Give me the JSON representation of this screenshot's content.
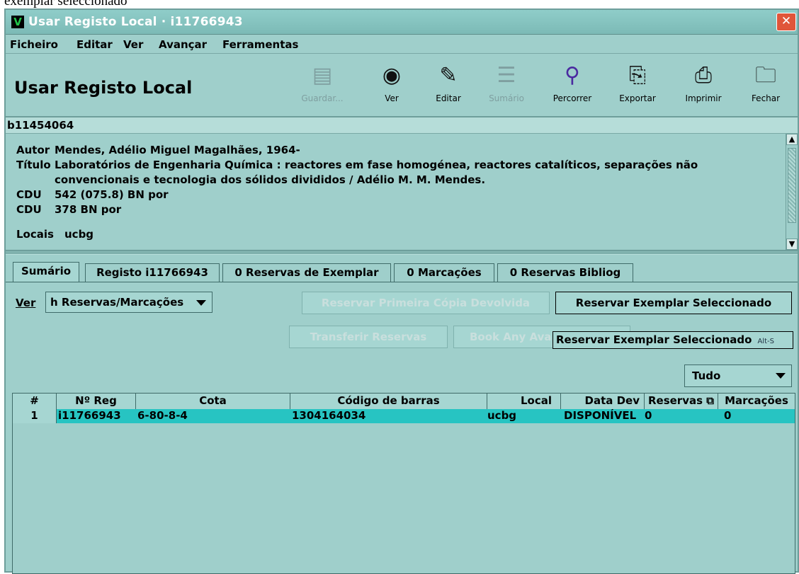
{
  "caption_fragment": "exemplar seleccionado",
  "window": {
    "title": "Usar Registo Local · i11766943",
    "close_glyph": "✕",
    "app_icon": "V"
  },
  "menu": [
    "Ficheiro",
    "Editar",
    "Ver",
    "Avançar",
    "Ferramentas"
  ],
  "toolbar": {
    "title": "Usar Registo Local",
    "buttons": [
      {
        "label": "Guardar...",
        "icon": "save-icon",
        "enabled": false
      },
      {
        "label": "Ver",
        "icon": "eye-icon",
        "enabled": true
      },
      {
        "label": "Editar",
        "icon": "edit-icon",
        "enabled": true
      },
      {
        "label": "Sumário",
        "icon": "summary-icon",
        "enabled": false
      },
      {
        "label": "Percorrer",
        "icon": "magnifier-icon",
        "enabled": true
      },
      {
        "label": "Exportar",
        "icon": "export-icon",
        "enabled": true
      },
      {
        "label": "Imprimir",
        "icon": "printer-icon",
        "enabled": true
      },
      {
        "label": "Fechar",
        "icon": "close-folder-icon",
        "enabled": true
      }
    ]
  },
  "record": {
    "bib_id": "b11454064",
    "fields": [
      {
        "label": "Autor",
        "value": "Mendes, Adélio Miguel Magalhães, 1964-"
      },
      {
        "label": "Título",
        "value": "Laboratórios de Engenharia Química : reactores em fase homogénea, reactores catalíticos, separações não"
      },
      {
        "label": "",
        "value": "convencionais e tecnologia dos sólidos divididos / Adélio M. M. Mendes."
      },
      {
        "label": "CDU",
        "value": "542 (075.8) BN por"
      },
      {
        "label": "CDU",
        "value": "378 BN por"
      },
      {
        "label": "Locais",
        "value": "ucbg"
      }
    ]
  },
  "tabs": [
    "Sumário",
    "Registo i11766943",
    "0 Reservas de Exemplar",
    "0 Marcações",
    "0 Reservas Bibliog"
  ],
  "summary": {
    "ver_label": "Ver",
    "ver_value": "h Reservas/Marcações",
    "buttons": {
      "reservar_primeira": "Reservar Primeira Cópia Devolvida",
      "reservar_exemplar": "Reservar Exemplar Seleccionado",
      "transferir": "Transferir Reservas",
      "book_any": "Book Any Ava"
    },
    "tooltip": {
      "text": "Reservar Exemplar Seleccionado",
      "accelerator": "Alt-S"
    },
    "filter_value": "Tudo"
  },
  "table": {
    "columns": [
      "#",
      "Nº Reg",
      "Cota",
      "Código de barras",
      "Local",
      "Data Dev",
      "Reservas",
      "Marcações"
    ],
    "rows": [
      [
        "1",
        "i11766943",
        "6-80-8-4",
        "1304164034",
        "ucbg",
        "DISPONÍVEL",
        "0",
        "0"
      ]
    ]
  }
}
